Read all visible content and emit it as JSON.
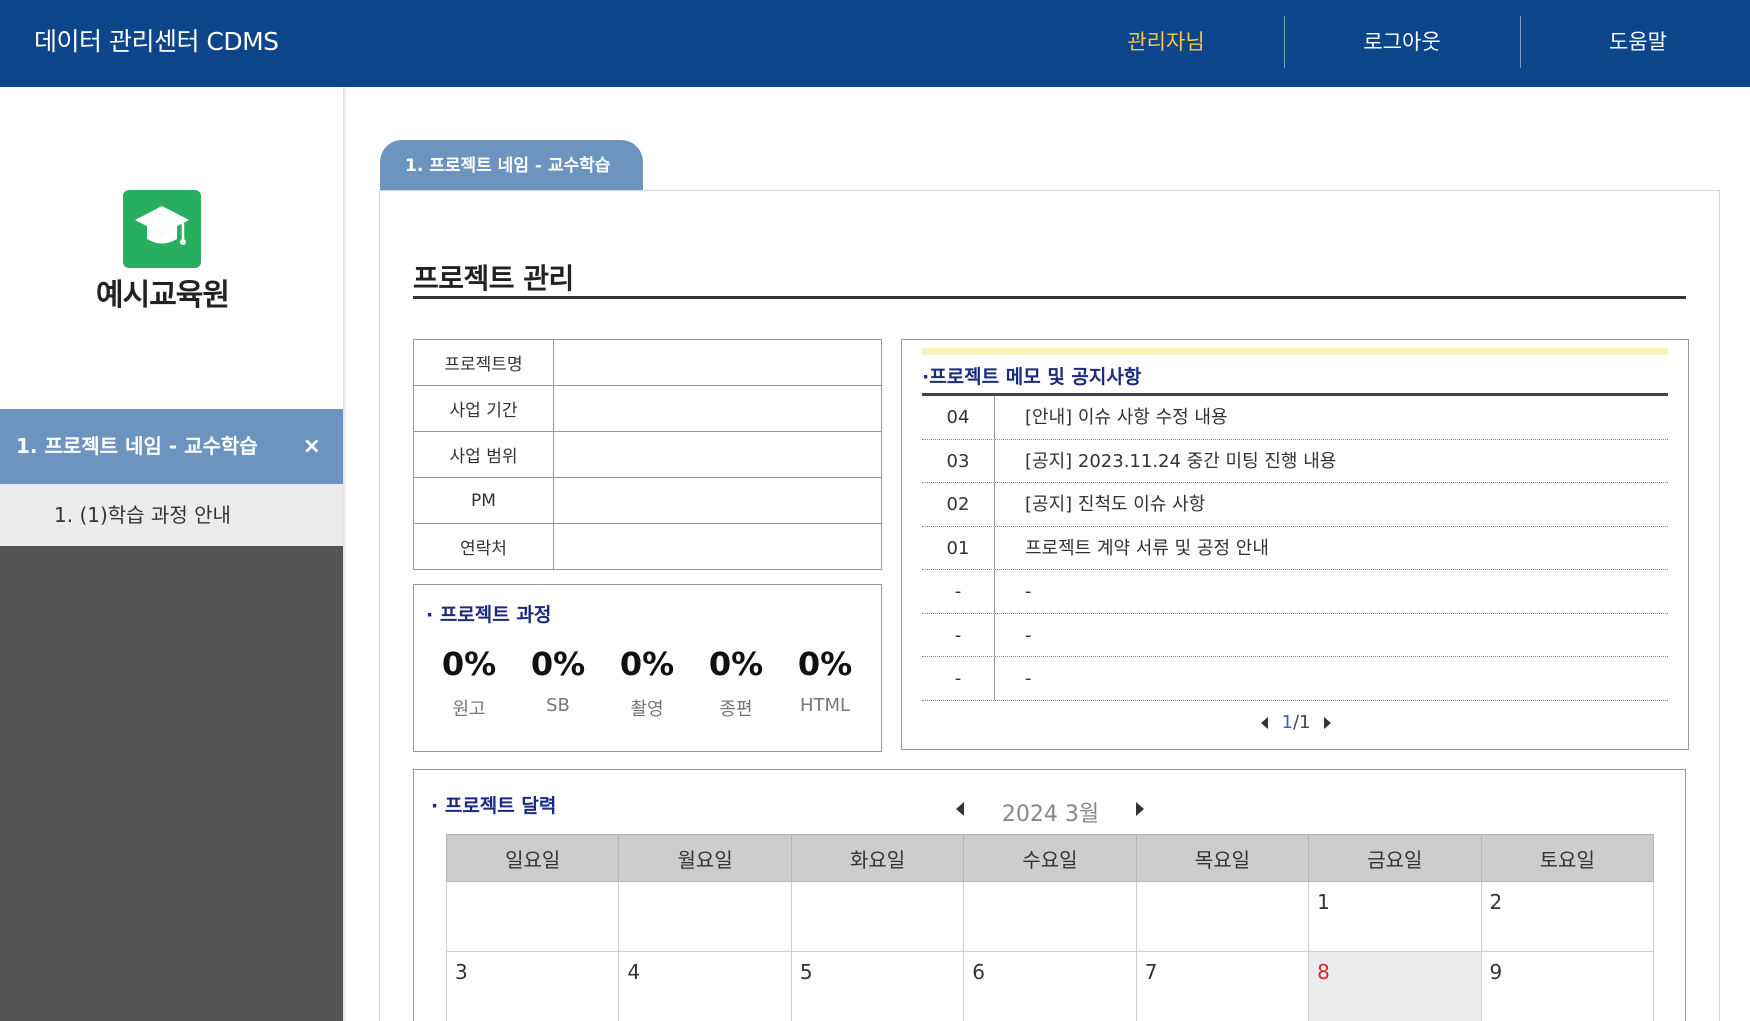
{
  "header": {
    "title": "데이터 관리센터 CDMS",
    "admin_label": "관리자님",
    "logout_label": "로그아웃",
    "help_label": "도움말"
  },
  "sidebar": {
    "org_name": "예시교육원",
    "project_label": "1. 프로젝트 네임 - 교수학습",
    "close_label": "×",
    "sub_items": [
      "1. (1)학습 과정 안내"
    ]
  },
  "tab": {
    "label": "1. 프로젝트 네임 - 교수학습"
  },
  "main": {
    "section_title": "프로젝트 관리"
  },
  "info_table": {
    "rows": [
      {
        "label": "프로젝트명",
        "value": ""
      },
      {
        "label": "사업 기간",
        "value": ""
      },
      {
        "label": "사업 범위",
        "value": ""
      },
      {
        "label": "PM",
        "value": ""
      },
      {
        "label": "연락처",
        "value": ""
      }
    ]
  },
  "progress": {
    "title": "· 프로젝트 과정",
    "items": [
      {
        "value": "0%",
        "label": "원고"
      },
      {
        "value": "0%",
        "label": "SB"
      },
      {
        "value": "0%",
        "label": "촬영"
      },
      {
        "value": "0%",
        "label": "종편"
      },
      {
        "value": "0%",
        "label": "HTML"
      }
    ]
  },
  "notice": {
    "title": "·프로젝트 메모 및 공지사항",
    "rows": [
      {
        "no": "04",
        "text": "[안내] 이슈 사항 수정 내용"
      },
      {
        "no": "03",
        "text": "[공지] 2023.11.24 중간 미팅 진행 내용"
      },
      {
        "no": "02",
        "text": "[공지] 진척도 이슈 사항"
      },
      {
        "no": "01",
        "text": "프로젝트 계약 서류 및 공정 안내"
      },
      {
        "no": "-",
        "text": "-"
      },
      {
        "no": "-",
        "text": "-"
      },
      {
        "no": "-",
        "text": "-"
      }
    ],
    "pager": {
      "current": "1",
      "total": "/1"
    }
  },
  "calendar": {
    "title": "· 프로젝트 달력",
    "month_label": "2024 3월",
    "weekdays": [
      "일요일",
      "월요일",
      "화요일",
      "수요일",
      "목요일",
      "금요일",
      "토요일"
    ],
    "weeks": [
      [
        "",
        "",
        "",
        "",
        "",
        "1",
        "2"
      ],
      [
        "3",
        "4",
        "5",
        "6",
        "7",
        "8",
        "9"
      ]
    ],
    "today": "8",
    "today_color": "#d9262b"
  },
  "colors": {
    "header_bg": "#0c4589",
    "accent": "#6d94bf",
    "admin_text": "#f4c843",
    "logo_green": "#27ae5f"
  }
}
